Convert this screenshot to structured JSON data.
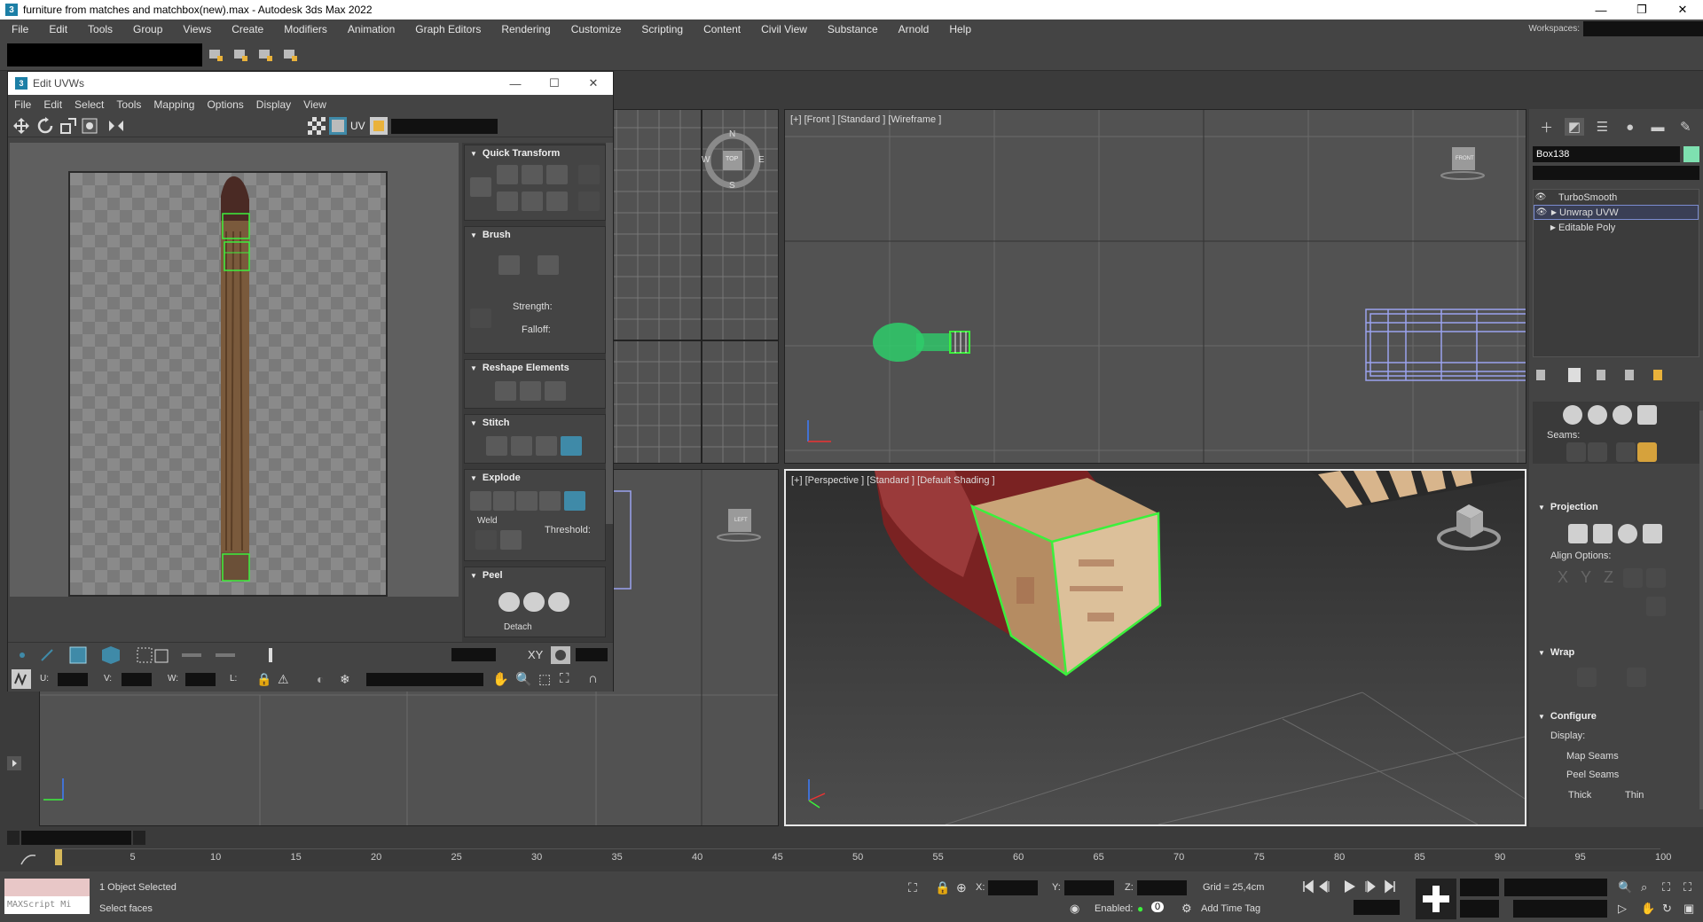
{
  "window": {
    "title": "furniture from matches and matchbox(new).max - Autodesk 3ds Max 2022",
    "app_icon": "3",
    "minimize": "—",
    "maximize": "❐",
    "close": "✕"
  },
  "menu": [
    "File",
    "Edit",
    "Tools",
    "Group",
    "Views",
    "Create",
    "Modifiers",
    "Animation",
    "Graph Editors",
    "Rendering",
    "Customize",
    "Scripting",
    "Content",
    "Civil View",
    "Substance",
    "Arnold",
    "Help"
  ],
  "workspaces_label": "Workspaces:",
  "uvw": {
    "title": "Edit UVWs",
    "menu": [
      "File",
      "Edit",
      "Select",
      "Tools",
      "Mapping",
      "Options",
      "Display",
      "View"
    ],
    "uv_label": "UV",
    "rollouts": {
      "quick_transform": "Quick Transform",
      "brush": "Brush",
      "strength": "Strength:",
      "falloff": "Falloff:",
      "reshape": "Reshape Elements",
      "stitch": "Stitch",
      "explode": "Explode",
      "weld": "Weld",
      "threshold": "Threshold:",
      "peel": "Peel",
      "detach": "Detach"
    },
    "xy_label": "XY",
    "u_label": "U:",
    "v_label": "V:",
    "w_label": "W:",
    "l_label": "L:"
  },
  "viewports": {
    "top_compass": {
      "n": "N",
      "s": "S",
      "w": "W",
      "e": "E",
      "center": "TOP"
    },
    "front_label": "[+] [Front ] [Standard ] [Wireframe ]",
    "front_cube": "FRONT",
    "left_cube": "LEFT",
    "perspective_label": "[+] [Perspective ] [Standard ] [Default Shading ]"
  },
  "command_panel": {
    "object_name": "Box138",
    "object_color": "#7ee0b0",
    "modifiers": [
      {
        "name": "TurboSmooth",
        "eye": true,
        "arrow": false,
        "selected": false
      },
      {
        "name": "Unwrap UVW",
        "eye": true,
        "arrow": true,
        "selected": true
      },
      {
        "name": "Editable Poly",
        "eye": false,
        "arrow": true,
        "selected": false
      }
    ],
    "seams_label": "Seams:",
    "projection": "Projection",
    "align_options": "Align Options:",
    "align_axes": [
      "X",
      "Y",
      "Z"
    ],
    "wrap": "Wrap",
    "configure": "Configure",
    "display_label": "Display:",
    "map_seams": "Map Seams",
    "peel_seams": "Peel Seams",
    "thick": "Thick",
    "thin": "Thin"
  },
  "timeline": {
    "ticks": [
      "5",
      "10",
      "15",
      "20",
      "25",
      "30",
      "35",
      "40",
      "45",
      "50",
      "55",
      "60",
      "65",
      "70",
      "75",
      "80",
      "85",
      "90",
      "95",
      "100"
    ]
  },
  "status": {
    "maxscript_placeholder": "MAXScript Mi",
    "selection": "1 Object Selected",
    "prompt": "Select faces",
    "x_label": "X:",
    "y_label": "Y:",
    "z_label": "Z:",
    "grid": "Grid = 25,4cm",
    "enabled": "Enabled:",
    "enabled_value": "0",
    "add_time_tag": "Add Time Tag"
  },
  "colors": {
    "selection_green": "#3cf03c",
    "wire_purple": "#9aa2ee",
    "accent_blue": "#3f8aa8"
  }
}
